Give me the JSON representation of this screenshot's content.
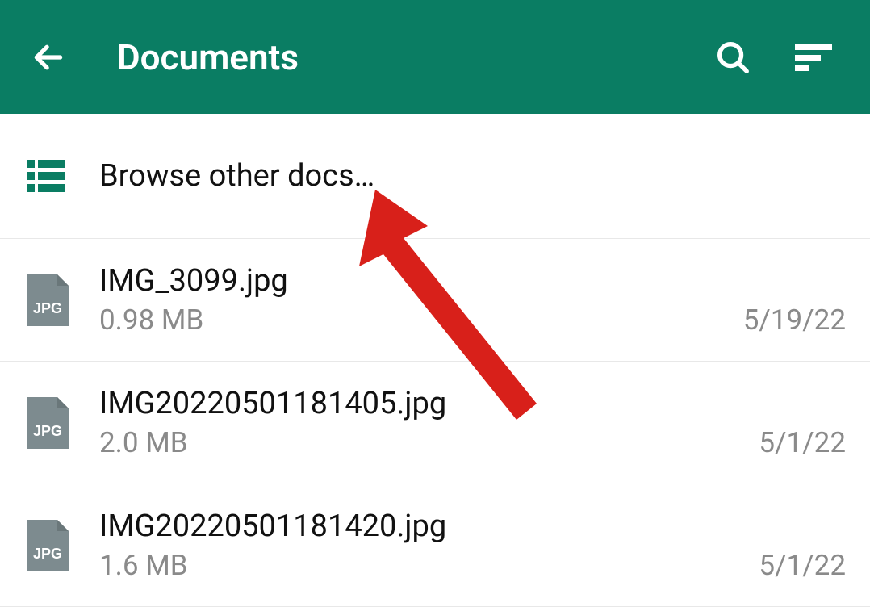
{
  "header": {
    "title": "Documents"
  },
  "browse": {
    "label": "Browse other docs…"
  },
  "files": [
    {
      "name": "IMG_3099.jpg",
      "size": "0.98 MB",
      "date": "5/19/22",
      "type": "JPG"
    },
    {
      "name": "IMG20220501181405.jpg",
      "size": "2.0 MB",
      "date": "5/1/22",
      "type": "JPG"
    },
    {
      "name": "IMG20220501181420.jpg",
      "size": "1.6 MB",
      "date": "5/1/22",
      "type": "JPG"
    }
  ]
}
